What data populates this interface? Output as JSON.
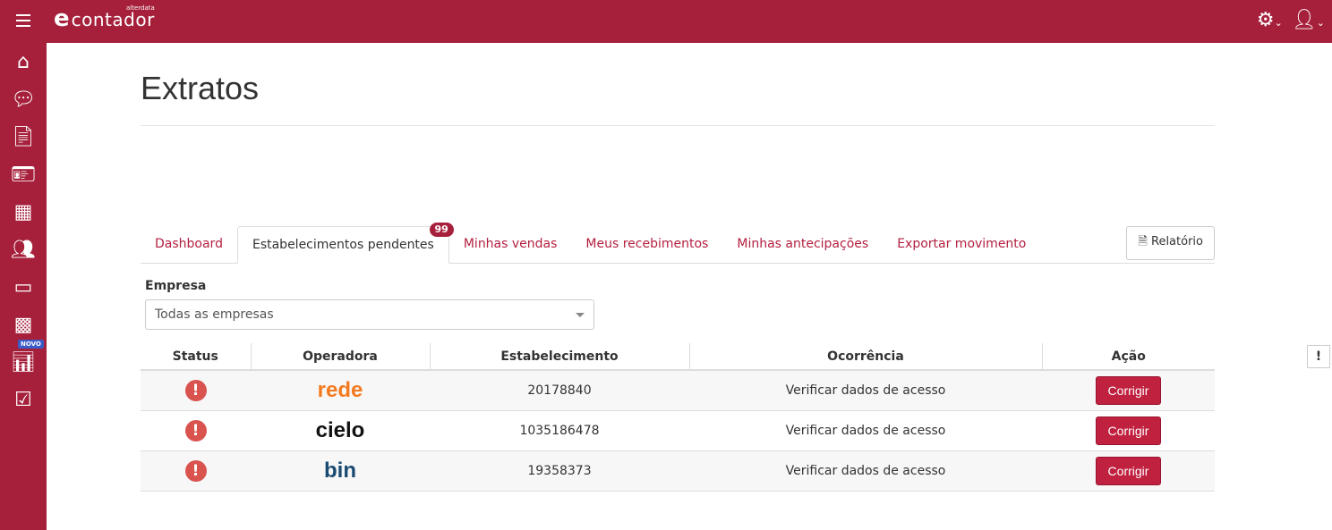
{
  "header": {
    "logo_main": "contador",
    "logo_sub": "alterdata",
    "logo_letter": "e"
  },
  "sidebar": {
    "novo_badge": "NOVO"
  },
  "page": {
    "title": "Extratos"
  },
  "tabs": [
    {
      "label": "Dashboard"
    },
    {
      "label": "Estabelecimentos pendentes",
      "badge": "99"
    },
    {
      "label": "Minhas vendas"
    },
    {
      "label": "Meus recebimentos"
    },
    {
      "label": "Minhas antecipações"
    },
    {
      "label": "Exportar movimento"
    }
  ],
  "report_button": "Relatório",
  "filter": {
    "label": "Empresa",
    "value": "Todas as empresas"
  },
  "table": {
    "headers": [
      "Status",
      "Operadora",
      "Estabelecimento",
      "Ocorrência",
      "Ação"
    ],
    "rows": [
      {
        "operadora": "rede",
        "estabelecimento": "20178840",
        "ocorrencia": "Verificar dados de acesso",
        "acao": "Corrigir"
      },
      {
        "operadora": "cielo",
        "estabelecimento": "1035186478",
        "ocorrencia": "Verificar dados de acesso",
        "acao": "Corrigir"
      },
      {
        "operadora": "bin",
        "estabelecimento": "19358373",
        "ocorrencia": "Verificar dados de acesso",
        "acao": "Corrigir"
      }
    ]
  }
}
